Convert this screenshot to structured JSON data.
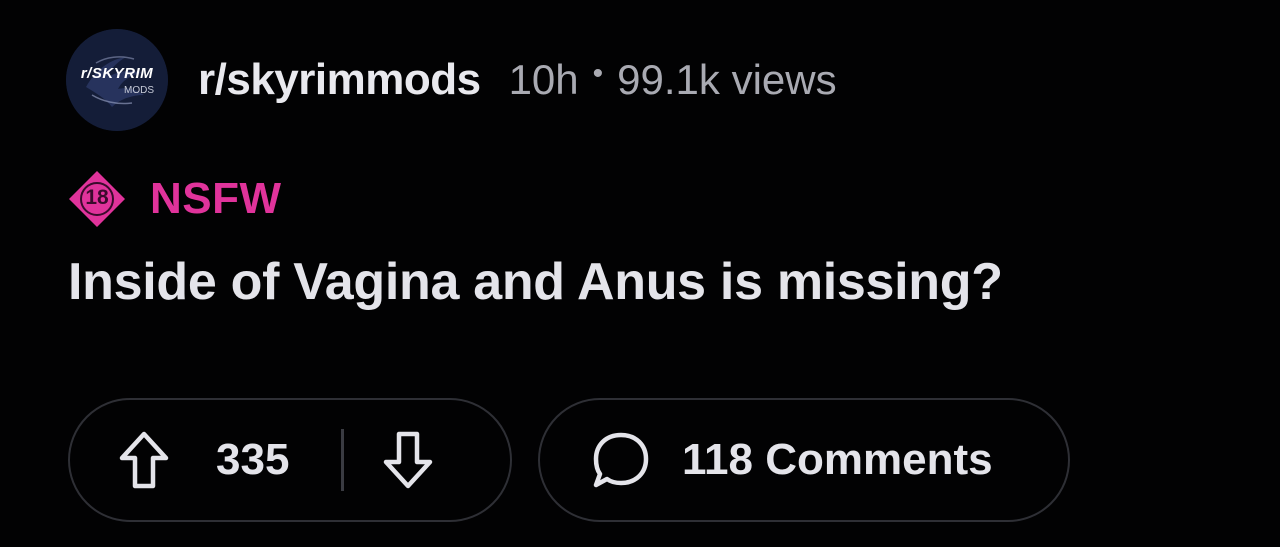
{
  "post": {
    "avatar": {
      "icon": "skyrim-mods-logo",
      "text_main": "r/SKYRIM",
      "text_sub": "MODS"
    },
    "subreddit": "r/skyrimmods",
    "age": "10h",
    "separator": "•",
    "views": "99.1k views",
    "nsfw": {
      "badge": "18",
      "label": "NSFW",
      "color": "#e0339b"
    },
    "title": "Inside of Vagina and Anus is missing?",
    "votes": {
      "count": "335",
      "up_icon": "upvote-arrow-icon",
      "down_icon": "downvote-arrow-icon"
    },
    "comments": {
      "label": "118 Comments",
      "icon": "comment-bubble-icon"
    }
  },
  "colors": {
    "background": "#020203",
    "text": "#e4e4ea",
    "muted": "#a9aab2",
    "nsfw": "#e0339b",
    "border": "#2e2f35"
  }
}
